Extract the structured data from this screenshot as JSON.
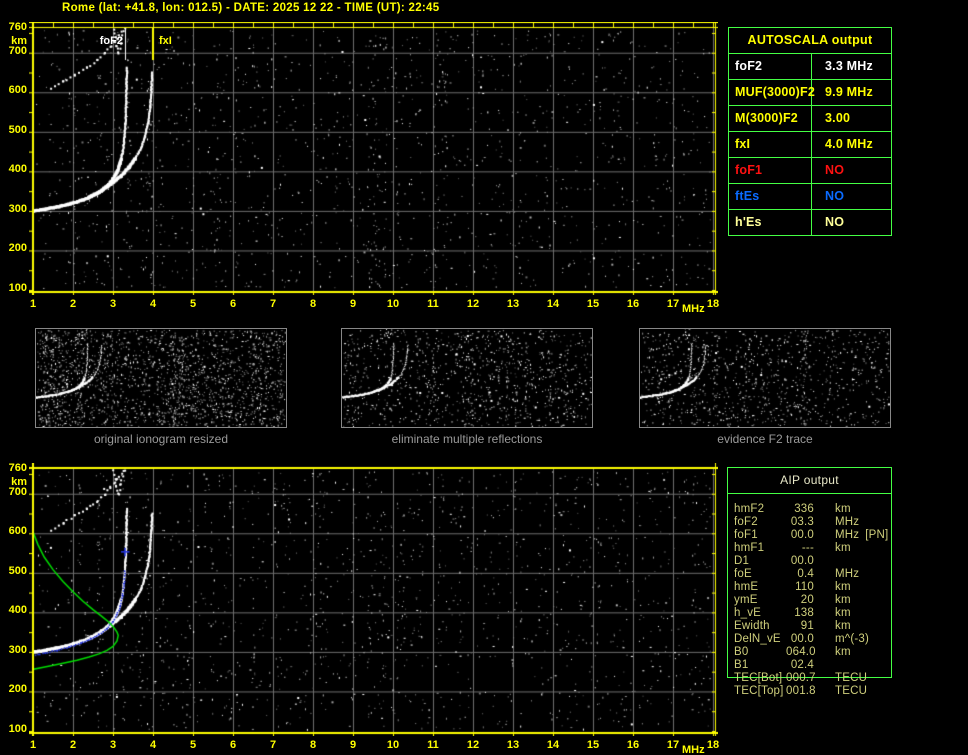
{
  "title": "Rome (lat: +41.8, lon: 012.5) - DATE: 2025 12 22 - TIME (UT): 22:45",
  "colors": {
    "accent_yellow": "#ffff00",
    "table_border_green": "#44ff44",
    "grid_gray": "#6f6f6f",
    "caption_gray": "#9a9a9a",
    "trace_white": "#ffffff",
    "profile_green": "#00dd00",
    "restored_blue": "#2233dd",
    "aip_text": "#cfcf7c",
    "aip_header": "#e8e8c8"
  },
  "autoscala_table": {
    "header": "AUTOSCALA output",
    "rows": [
      {
        "label": "foF2",
        "value": "3.3 MHz",
        "color": "#ffffff"
      },
      {
        "label": "MUF(3000)F2",
        "value": "9.9 MHz",
        "color": "#ffff00"
      },
      {
        "label": "M(3000)F2",
        "value": "3.00",
        "color": "#ffff00"
      },
      {
        "label": "fxI",
        "value": "4.0 MHz",
        "color": "#ffff00"
      },
      {
        "label": "foF1",
        "value": "NO",
        "color": "#ff1111"
      },
      {
        "label": "ftEs",
        "value": "NO",
        "color": "#0a6bff"
      },
      {
        "label": "h'Es",
        "value": "NO",
        "color": "#ffff99"
      }
    ]
  },
  "thumbnails": [
    {
      "caption": "original ionogram resized"
    },
    {
      "caption": "eliminate multiple reflections"
    },
    {
      "caption": "evidence F2 trace"
    }
  ],
  "aip_table": {
    "header": "AIP output",
    "rows": [
      [
        "hmF2",
        "336",
        "km",
        ""
      ],
      [
        "foF2",
        "03.3",
        "MHz",
        ""
      ],
      [
        "foF1",
        "00.0",
        "MHz",
        "[PN]"
      ],
      [
        "hmF1",
        "---",
        "km",
        ""
      ],
      [
        "D1",
        "00.0",
        "",
        ""
      ],
      [
        "foE",
        "0.4",
        "MHz",
        ""
      ],
      [
        "hmE",
        "110",
        "km",
        ""
      ],
      [
        "ymE",
        "20",
        "km",
        ""
      ],
      [
        "h_vE",
        "138",
        "km",
        ""
      ],
      [
        "Ewidth",
        "91",
        "km",
        ""
      ],
      [
        "DelN_vE",
        "00.0",
        "m^(-3)",
        ""
      ],
      [
        "B0",
        "064.0",
        "km",
        ""
      ],
      [
        "B1",
        "02.4",
        "",
        ""
      ],
      [
        "TEC[Bot]",
        "000.7",
        "TECU",
        ""
      ],
      [
        "TEC[Top]",
        "001.8",
        "TECU",
        ""
      ]
    ]
  },
  "chart_data": [
    {
      "type": "scatter",
      "title": "autoscaled ionogram",
      "xlabel": "MHz",
      "ylabel": "km",
      "xlim": [
        1,
        18
      ],
      "ylim": [
        100,
        760
      ],
      "grid": true,
      "xticks": [
        1,
        2,
        3,
        4,
        5,
        6,
        7,
        8,
        9,
        10,
        11,
        12,
        13,
        14,
        15,
        16,
        17,
        18
      ],
      "yticks": [
        760,
        700,
        600,
        500,
        400,
        300,
        200,
        100
      ],
      "markers": [
        {
          "label": "foF2",
          "f": 3.3,
          "color": "#ffffff",
          "label_side": "left"
        },
        {
          "label": "fxI",
          "f": 4.0,
          "color": "#ffff00",
          "label_side": "right"
        }
      ],
      "series": [
        {
          "name": "f2-trace-o-mode",
          "color": "#ffffff",
          "style": "trace",
          "points": [
            [
              1.0,
              299
            ],
            [
              1.3,
              304
            ],
            [
              1.6,
              310
            ],
            [
              1.9,
              317
            ],
            [
              2.2,
              326
            ],
            [
              2.45,
              336
            ],
            [
              2.65,
              347
            ],
            [
              2.85,
              362
            ],
            [
              3.0,
              380
            ],
            [
              3.1,
              398
            ],
            [
              3.18,
              420
            ],
            [
              3.24,
              446
            ],
            [
              3.28,
              478
            ],
            [
              3.31,
              520
            ],
            [
              3.33,
              570
            ],
            [
              3.34,
              625
            ],
            [
              3.35,
              662
            ]
          ]
        },
        {
          "name": "f2-trace-x-mode",
          "color": "#ffffff",
          "style": "trace",
          "points": [
            [
              2.4,
              334
            ],
            [
              2.7,
              350
            ],
            [
              2.95,
              368
            ],
            [
              3.2,
              388
            ],
            [
              3.4,
              410
            ],
            [
              3.55,
              432
            ],
            [
              3.7,
              458
            ],
            [
              3.8,
              488
            ],
            [
              3.88,
              522
            ],
            [
              3.93,
              562
            ],
            [
              3.96,
              608
            ],
            [
              3.98,
              650
            ]
          ]
        },
        {
          "name": "multiple-reflection-trace",
          "color": "#ffffff",
          "style": "sparse",
          "points": [
            [
              1.45,
              608
            ],
            [
              1.75,
              626
            ],
            [
              2.05,
              644
            ],
            [
              2.35,
              662
            ],
            [
              2.6,
              680
            ],
            [
              2.8,
              698
            ],
            [
              2.95,
              716
            ],
            [
              3.1,
              736
            ],
            [
              3.3,
              760
            ]
          ]
        },
        {
          "name": "second-hop-cusp",
          "color": "#ffffff",
          "style": "sparse",
          "points": [
            [
              3.02,
              758
            ],
            [
              3.09,
              718
            ],
            [
              3.14,
              700
            ],
            [
              3.2,
              722
            ],
            [
              3.26,
              756
            ]
          ]
        }
      ]
    },
    {
      "type": "scatter",
      "title": "ionogram with restored trace and electron density profile",
      "xlabel": "MHz",
      "ylabel": "km",
      "xlim": [
        1,
        18
      ],
      "ylim": [
        100,
        760
      ],
      "grid": true,
      "xticks": [
        1,
        2,
        3,
        4,
        5,
        6,
        7,
        8,
        9,
        10,
        11,
        12,
        13,
        14,
        15,
        16,
        17,
        18
      ],
      "yticks": [
        760,
        700,
        600,
        500,
        400,
        300,
        200,
        100
      ],
      "markers": [],
      "series": [
        {
          "name": "f2-trace-o-mode",
          "color": "#ffffff",
          "style": "trace",
          "points": [
            [
              1.0,
              299
            ],
            [
              1.3,
              304
            ],
            [
              1.6,
              310
            ],
            [
              1.9,
              317
            ],
            [
              2.2,
              326
            ],
            [
              2.45,
              336
            ],
            [
              2.65,
              347
            ],
            [
              2.85,
              362
            ],
            [
              3.0,
              380
            ],
            [
              3.1,
              398
            ],
            [
              3.18,
              420
            ],
            [
              3.24,
              446
            ],
            [
              3.28,
              478
            ],
            [
              3.31,
              520
            ],
            [
              3.33,
              570
            ],
            [
              3.34,
              625
            ],
            [
              3.35,
              662
            ]
          ]
        },
        {
          "name": "f2-trace-x-mode",
          "color": "#ffffff",
          "style": "trace",
          "points": [
            [
              2.4,
              334
            ],
            [
              2.7,
              350
            ],
            [
              2.95,
              368
            ],
            [
              3.2,
              388
            ],
            [
              3.4,
              410
            ],
            [
              3.55,
              432
            ],
            [
              3.7,
              458
            ],
            [
              3.8,
              488
            ],
            [
              3.88,
              522
            ],
            [
              3.93,
              562
            ],
            [
              3.96,
              608
            ],
            [
              3.98,
              650
            ]
          ]
        },
        {
          "name": "multiple-reflection-trace",
          "color": "#ffffff",
          "style": "sparse",
          "points": [
            [
              1.45,
              608
            ],
            [
              1.75,
              626
            ],
            [
              2.05,
              644
            ],
            [
              2.35,
              662
            ],
            [
              2.6,
              680
            ],
            [
              2.8,
              698
            ],
            [
              2.95,
              716
            ],
            [
              3.1,
              736
            ],
            [
              3.3,
              760
            ]
          ]
        },
        {
          "name": "second-hop-cusp",
          "color": "#ffffff",
          "style": "sparse",
          "points": [
            [
              3.02,
              758
            ],
            [
              3.09,
              718
            ],
            [
              3.14,
              700
            ],
            [
              3.2,
              722
            ],
            [
              3.26,
              756
            ]
          ]
        },
        {
          "name": "restored-f2-trace",
          "color": "#2233dd",
          "style": "dots",
          "points": [
            [
              1.0,
              291
            ],
            [
              1.3,
              297
            ],
            [
              1.6,
              304
            ],
            [
              1.9,
              312
            ],
            [
              2.2,
              322
            ],
            [
              2.45,
              333
            ],
            [
              2.65,
              344
            ],
            [
              2.85,
              359
            ],
            [
              3.0,
              376
            ],
            [
              3.1,
              394
            ],
            [
              3.18,
              416
            ],
            [
              3.24,
              442
            ],
            [
              3.28,
              472
            ],
            [
              3.3,
              505
            ]
          ],
          "end_marker": [
            3.3,
            553
          ]
        },
        {
          "name": "electron-density-profile",
          "color": "#00dd00",
          "style": "line",
          "points": [
            [
              1.0,
              604
            ],
            [
              1.12,
              572
            ],
            [
              1.28,
              540
            ],
            [
              1.5,
              508
            ],
            [
              1.75,
              478
            ],
            [
              2.0,
              452
            ],
            [
              2.25,
              428
            ],
            [
              2.5,
              407
            ],
            [
              2.72,
              390
            ],
            [
              2.9,
              375
            ],
            [
              3.02,
              362
            ],
            [
              3.1,
              350
            ],
            [
              3.13,
              342
            ],
            [
              3.1,
              328
            ],
            [
              3.0,
              314
            ],
            [
              2.85,
              304
            ],
            [
              2.65,
              295
            ],
            [
              2.4,
              287
            ],
            [
              2.1,
              279
            ],
            [
              1.78,
              272
            ],
            [
              1.45,
              265
            ],
            [
              1.2,
              260
            ],
            [
              1.0,
              256
            ]
          ]
        }
      ]
    }
  ]
}
